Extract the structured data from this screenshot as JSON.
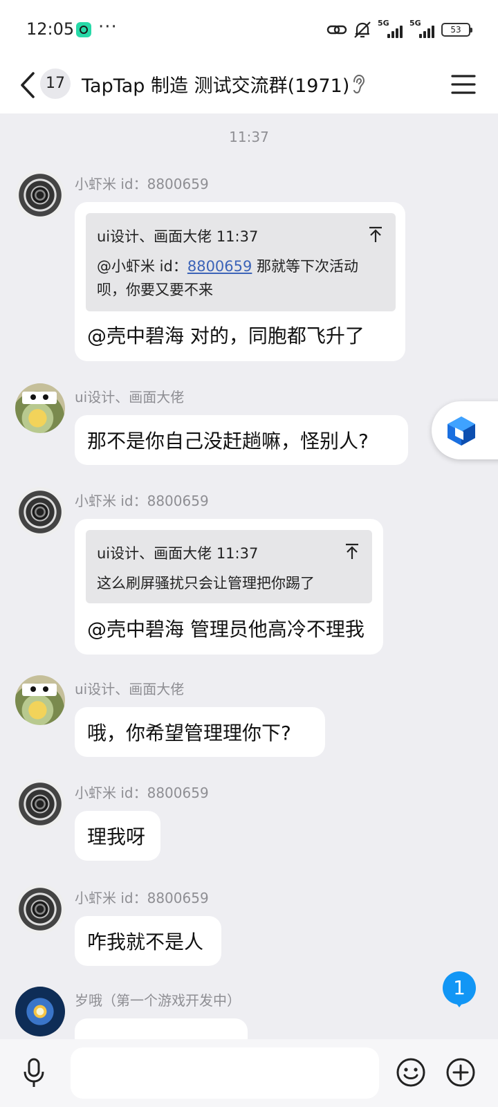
{
  "status_bar": {
    "time": "12:05",
    "dots": "···",
    "signal_1": "5G",
    "signal_2": "5G",
    "battery": "53"
  },
  "header": {
    "unread_count": "17",
    "title": "TapTap 制造 测试交流群(1971)",
    "icons": [
      "back-icon",
      "ear-icon",
      "menu-icon"
    ]
  },
  "chat": {
    "time_separator": "11:37",
    "messages": [
      {
        "sender": "小虾米 id：8800659",
        "avatar": "flower",
        "quote": {
          "head": "ui设计、画面大佬 11:37",
          "body_prefix": "@小虾米 id：",
          "body_link": "8800659",
          "body_suffix": " 那就等下次活动",
          "body_line2": "呗，你要又要不来"
        },
        "text": "@壳中碧海 对的，同胞都飞升了"
      },
      {
        "sender": "ui设计、画面大佬",
        "avatar": "dog",
        "text": "那不是你自己没赶趟嘛，怪别人?"
      },
      {
        "sender": "小虾米 id：8800659",
        "avatar": "flower",
        "quote": {
          "head": "ui设计、画面大佬 11:37",
          "body": "这么刷屏骚扰只会让管理把你踢了"
        },
        "text": "@壳中碧海 管理员他高冷不理我"
      },
      {
        "sender": "ui设计、画面大佬",
        "avatar": "dog",
        "text": "哦，你希望管理理你下?"
      },
      {
        "sender": "小虾米 id：8800659",
        "avatar": "flower",
        "text": "理我呀"
      },
      {
        "sender": "小虾米 id：8800659",
        "avatar": "flower",
        "text": "咋我就不是人"
      },
      {
        "sender": "岁哦（第一个游戏开发中）",
        "avatar": "space"
      }
    ]
  },
  "new_message_badge": "1",
  "input_bar": {
    "placeholder": "",
    "icons": [
      "microphone-icon",
      "emoji-icon",
      "plus-icon"
    ]
  },
  "colors": {
    "background": "#eeeef2",
    "bubble": "#ffffff",
    "quote_bg": "#e6e6e8",
    "link": "#3b63b8",
    "badge": "#1296f5"
  }
}
